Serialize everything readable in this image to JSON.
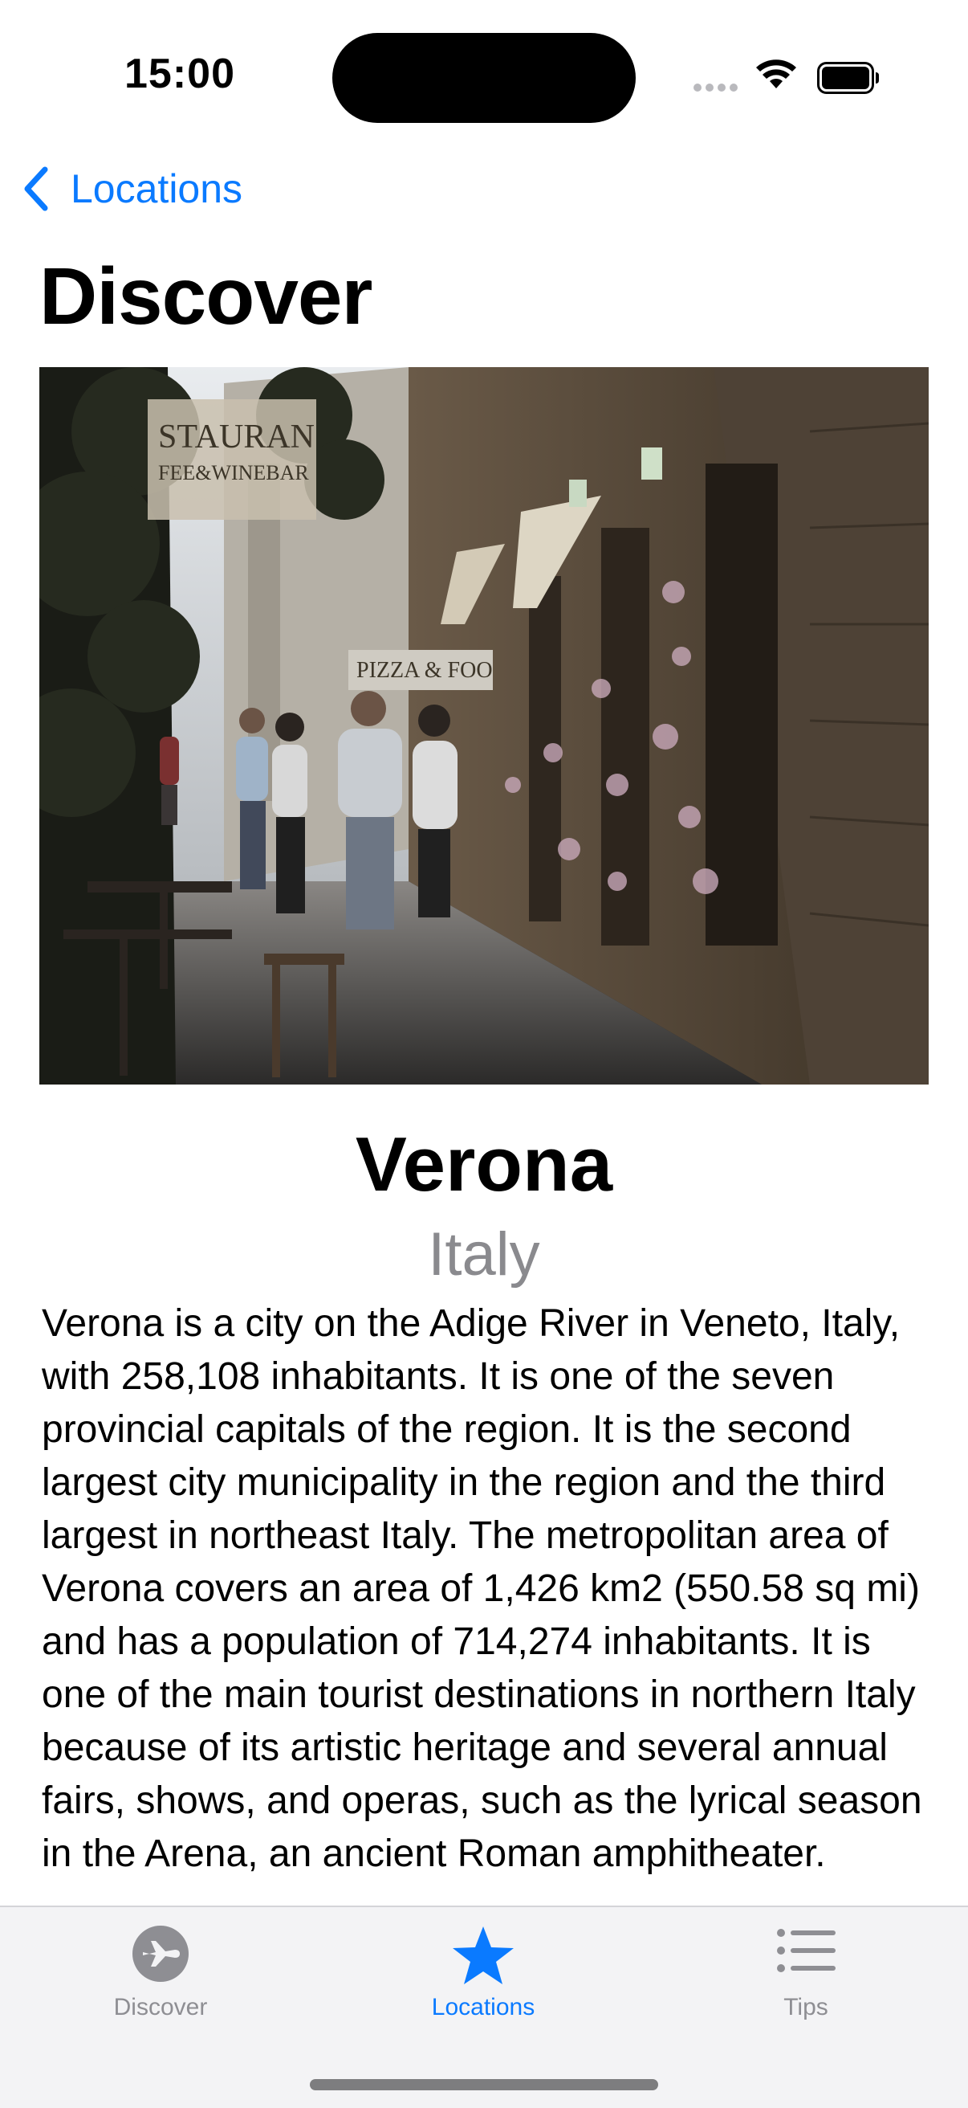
{
  "status_bar": {
    "time": "15:00"
  },
  "nav": {
    "back_label": "Locations"
  },
  "page": {
    "title": "Discover"
  },
  "location": {
    "city": "Verona",
    "country": "Italy",
    "description": "Verona is a city on the Adige River in Veneto, Italy, with 258,108 inhabitants. It is one of the seven provincial capitals of the region. It is the second largest city municipality in the region and the third largest in northeast Italy. The metropolitan area of Verona covers an area of 1,426 km2 (550.58 sq mi) and has a population of 714,274 inhabitants. It is one of the main tourist destinations in northern Italy because of its artistic heritage and several annual fairs, shows, and operas, such as the lyrical season in the Arena, an ancient Roman amphitheater.",
    "photo_signs": {
      "restaurant": "STAURAN",
      "restaurant_sub": "FEE&WINEBAR",
      "pizza": "PIZZA & FOO"
    }
  },
  "tab_bar": {
    "tabs": [
      {
        "label": "Discover",
        "icon": "airplane-circle-icon",
        "active": false
      },
      {
        "label": "Locations",
        "icon": "star-icon",
        "active": true
      },
      {
        "label": "Tips",
        "icon": "list-icon",
        "active": false
      }
    ]
  },
  "colors": {
    "accent": "#0a7aff",
    "inactive": "#8e8e93",
    "tab_bar_bg": "#f3f3f5",
    "secondary_text": "#8a8a8e"
  }
}
